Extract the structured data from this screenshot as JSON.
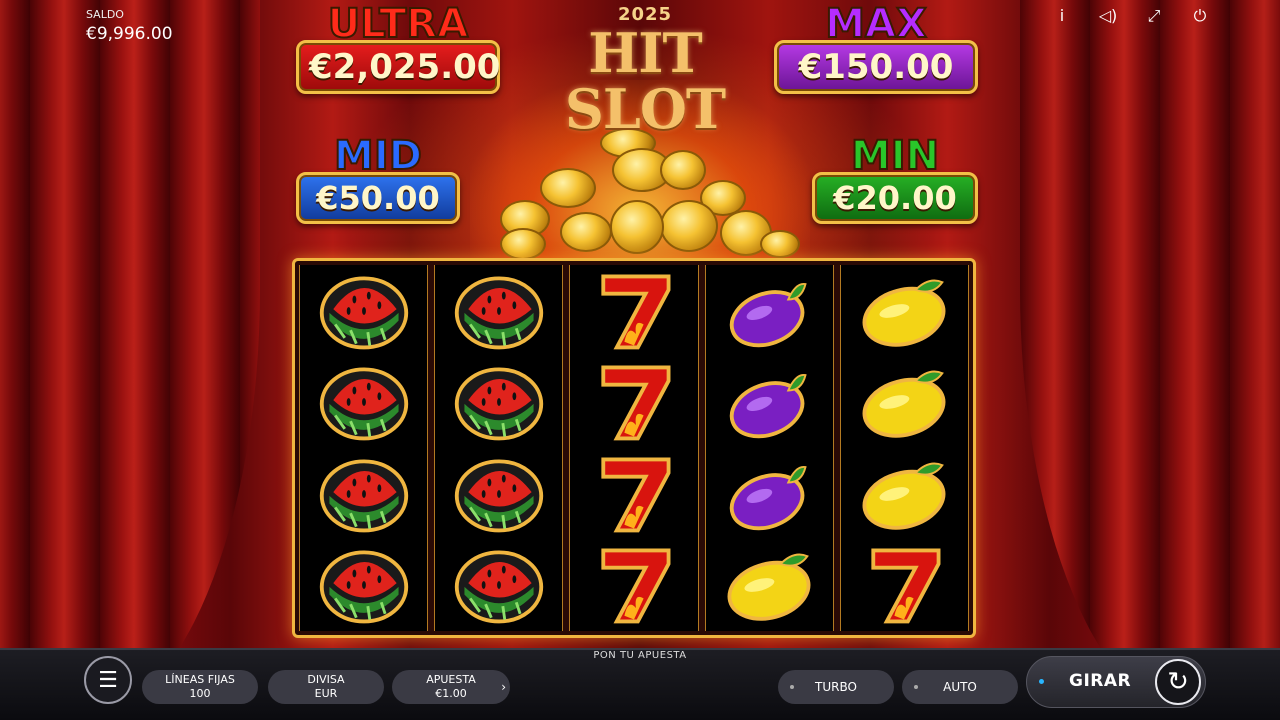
{
  "balance": {
    "label": "SALDO",
    "value": "€9,996.00"
  },
  "top_icons": [
    {
      "name": "info-icon",
      "glyph": "i"
    },
    {
      "name": "sound-icon",
      "glyph": "◁)"
    },
    {
      "name": "fullscreen-icon",
      "glyph": "⤢"
    },
    {
      "name": "power-icon",
      "glyph": "⏻"
    }
  ],
  "logo": {
    "year": "2025",
    "name": "HIT SLOT"
  },
  "jackpots": {
    "ultra": {
      "title": "ULTRA",
      "amount": "€2,025.00",
      "color": "#e81d1d"
    },
    "max": {
      "title": "MAX",
      "amount": "€150.00",
      "color": "#b73ae6"
    },
    "mid": {
      "title": "MID",
      "amount": "€50.00",
      "color": "#2f74f0"
    },
    "min": {
      "title": "MIN",
      "amount": "€20.00",
      "color": "#27b125"
    }
  },
  "reels": [
    [
      "watermelon",
      "watermelon",
      "watermelon",
      "watermelon"
    ],
    [
      "watermelon",
      "watermelon",
      "watermelon",
      "watermelon"
    ],
    [
      "seven",
      "seven",
      "seven",
      "seven"
    ],
    [
      "plum",
      "plum",
      "plum",
      "lemon"
    ],
    [
      "lemon",
      "lemon",
      "lemon",
      "seven"
    ]
  ],
  "bottom": {
    "hint": "PON TU APUESTA",
    "lines": {
      "label": "LÍNEAS FIJAS",
      "value": "100"
    },
    "currency": {
      "label": "DIVISA",
      "value": "EUR"
    },
    "bet": {
      "label": "APUESTA",
      "value": "€1.00"
    },
    "turbo": "TURBO",
    "auto": "AUTO",
    "spin": "GIRAR"
  }
}
